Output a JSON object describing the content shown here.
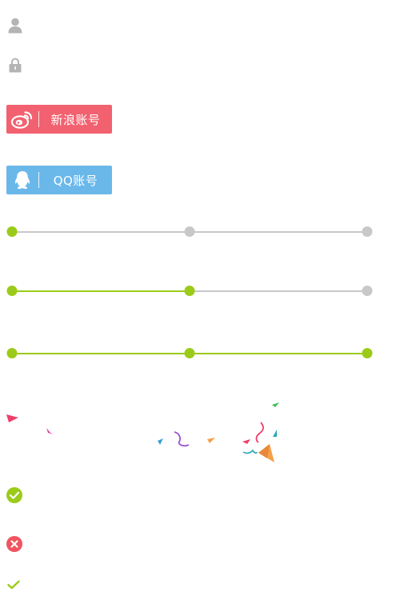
{
  "login": {
    "username_icon": "user-icon",
    "password_icon": "lock-icon"
  },
  "social": {
    "weibo": {
      "label": "新浪账号",
      "icon": "weibo-icon",
      "color": "#f2616f"
    },
    "qq": {
      "label": "QQ账号",
      "icon": "qq-penguin-icon",
      "color": "#6ab8ea"
    }
  },
  "progress": {
    "active_color": "#9bcb1a",
    "inactive_color": "#c8c8c8",
    "total_steps": 3,
    "bars": [
      {
        "completed_steps": 1
      },
      {
        "completed_steps": 2
      },
      {
        "completed_steps": 3
      }
    ]
  },
  "status_icons": {
    "success": {
      "icon": "check-circle-icon",
      "color": "#9bcb1a"
    },
    "error": {
      "icon": "close-circle-icon",
      "color": "#f0555f"
    },
    "check": {
      "icon": "checkmark-icon",
      "color": "#9bcb1a"
    }
  }
}
